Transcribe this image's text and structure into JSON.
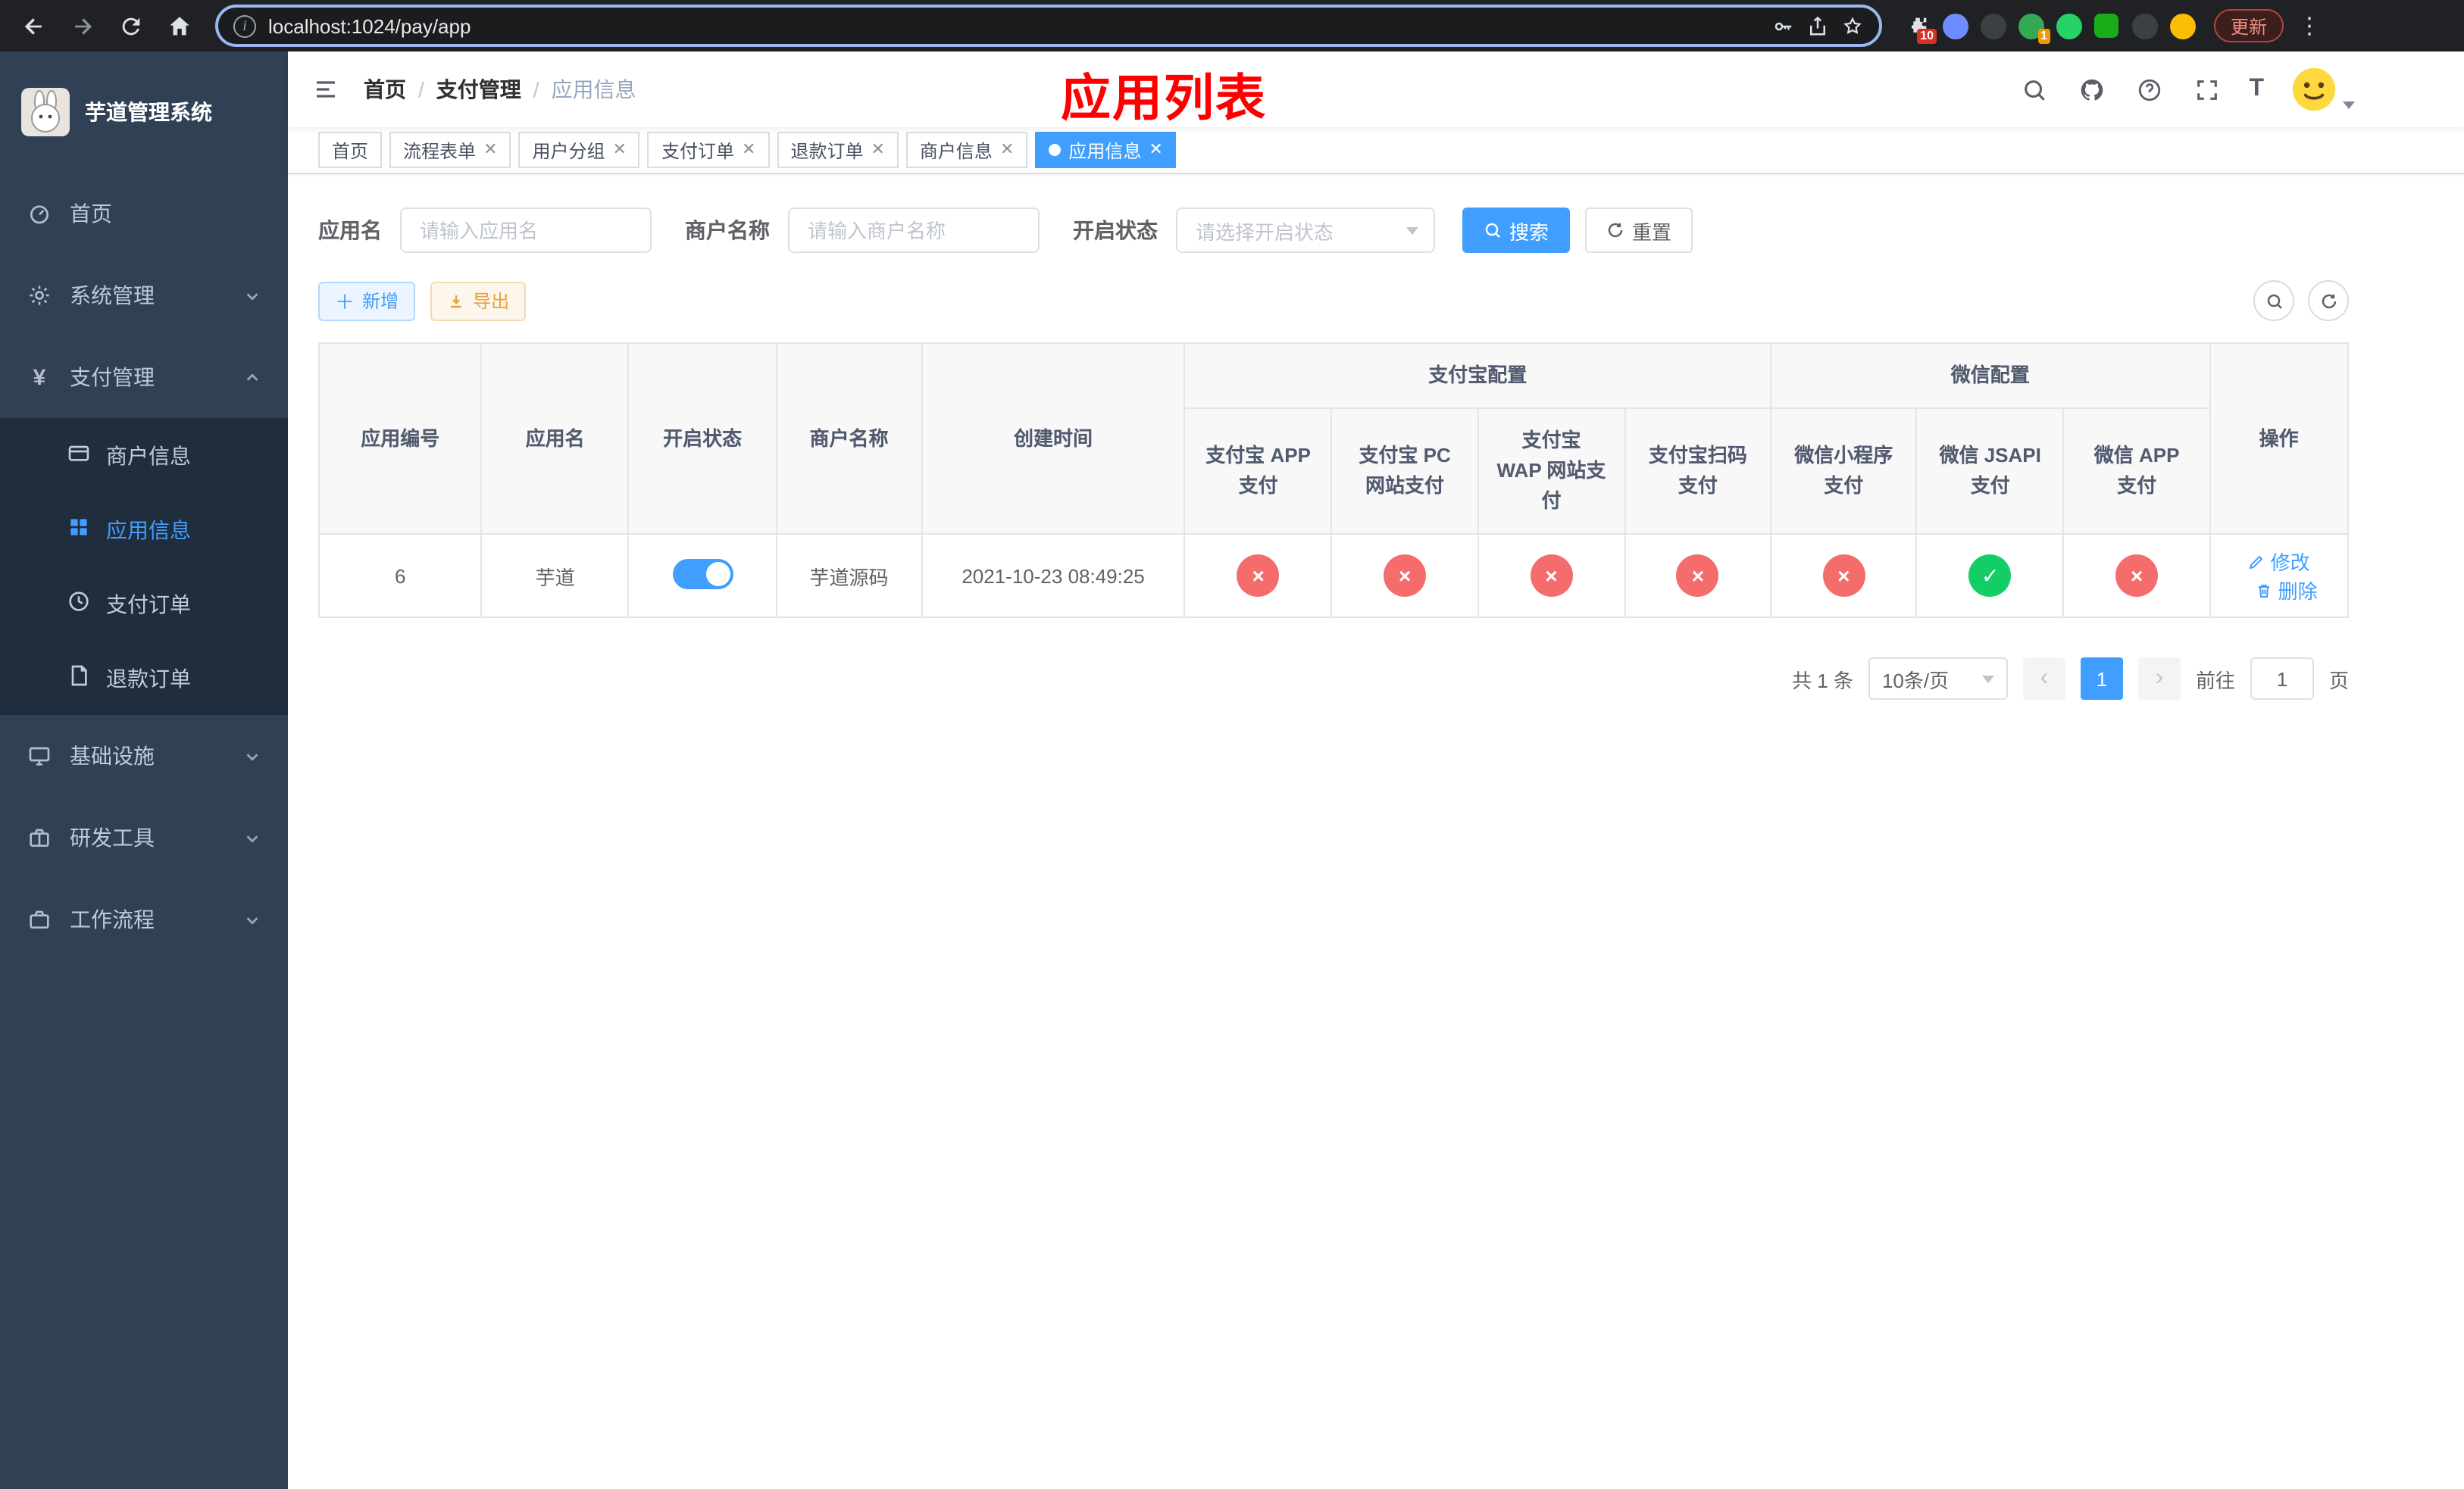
{
  "browser": {
    "url": "localhost:1024/pay/app",
    "update_label": "更新",
    "puzzle_badge": "10",
    "green_badge": "1"
  },
  "sidebar": {
    "title": "芋道管理系统",
    "home": "首页",
    "system": "系统管理",
    "payment": "支付管理",
    "merchant_info": "商户信息",
    "app_info": "应用信息",
    "pay_order": "支付订单",
    "refund_order": "退款订单",
    "infra": "基础设施",
    "dev_tools": "研发工具",
    "workflow": "工作流程"
  },
  "breadcrumb": {
    "home": "首页",
    "payment": "支付管理",
    "current": "应用信息"
  },
  "annotation": "应用列表",
  "tabs": [
    {
      "label": "首页",
      "closable": false,
      "active": false
    },
    {
      "label": "流程表单",
      "closable": true,
      "active": false
    },
    {
      "label": "用户分组",
      "closable": true,
      "active": false
    },
    {
      "label": "支付订单",
      "closable": true,
      "active": false
    },
    {
      "label": "退款订单",
      "closable": true,
      "active": false
    },
    {
      "label": "商户信息",
      "closable": true,
      "active": false
    },
    {
      "label": "应用信息",
      "closable": true,
      "active": true
    }
  ],
  "filters": {
    "app_name_label": "应用名",
    "app_name_placeholder": "请输入应用名",
    "merchant_label": "商户名称",
    "merchant_placeholder": "请输入商户名称",
    "status_label": "开启状态",
    "status_placeholder": "请选择开启状态",
    "search": "搜索",
    "reset": "重置"
  },
  "toolbar": {
    "add": "新增",
    "export": "导出"
  },
  "table": {
    "headers": {
      "app_id": "应用编号",
      "app_name": "应用名",
      "status": "开启状态",
      "merchant": "商户名称",
      "created": "创建时间",
      "alipay_group": "支付宝配置",
      "wechat_group": "微信配置",
      "alipay_app": "支付宝 APP 支付",
      "alipay_pc": "支付宝 PC 网站支付",
      "alipay_wap": "支付宝 WAP 网站支付",
      "alipay_scan": "支付宝扫码支付",
      "wx_lite": "微信小程序支付",
      "wx_jsapi": "微信 JSAPI 支付",
      "wx_app": "微信 APP 支付",
      "actions": "操作"
    },
    "rows": [
      {
        "app_id": "6",
        "app_name": "芋道",
        "status_on": true,
        "merchant": "芋道源码",
        "created": "2021-10-23 08:49:25",
        "alipay_app": false,
        "alipay_pc": false,
        "alipay_wap": false,
        "alipay_scan": false,
        "wx_lite": false,
        "wx_jsapi": true,
        "wx_app": false,
        "edit": "修改",
        "delete": "删除"
      }
    ]
  },
  "icons": {
    "yes": "✓",
    "no": "×"
  },
  "pagination": {
    "total": "共 1 条",
    "page_size": "10条/页",
    "page": "1",
    "goto": "前往",
    "goto_value": "1",
    "unit": "页"
  },
  "colors": {
    "primary": "#409eff",
    "success": "#13ce66",
    "danger": "#f56c6c",
    "warning": "#e6a23c",
    "annotation": "#ff0000",
    "sidebar_bg": "#304156",
    "submenu_bg": "#1f2d3d"
  }
}
